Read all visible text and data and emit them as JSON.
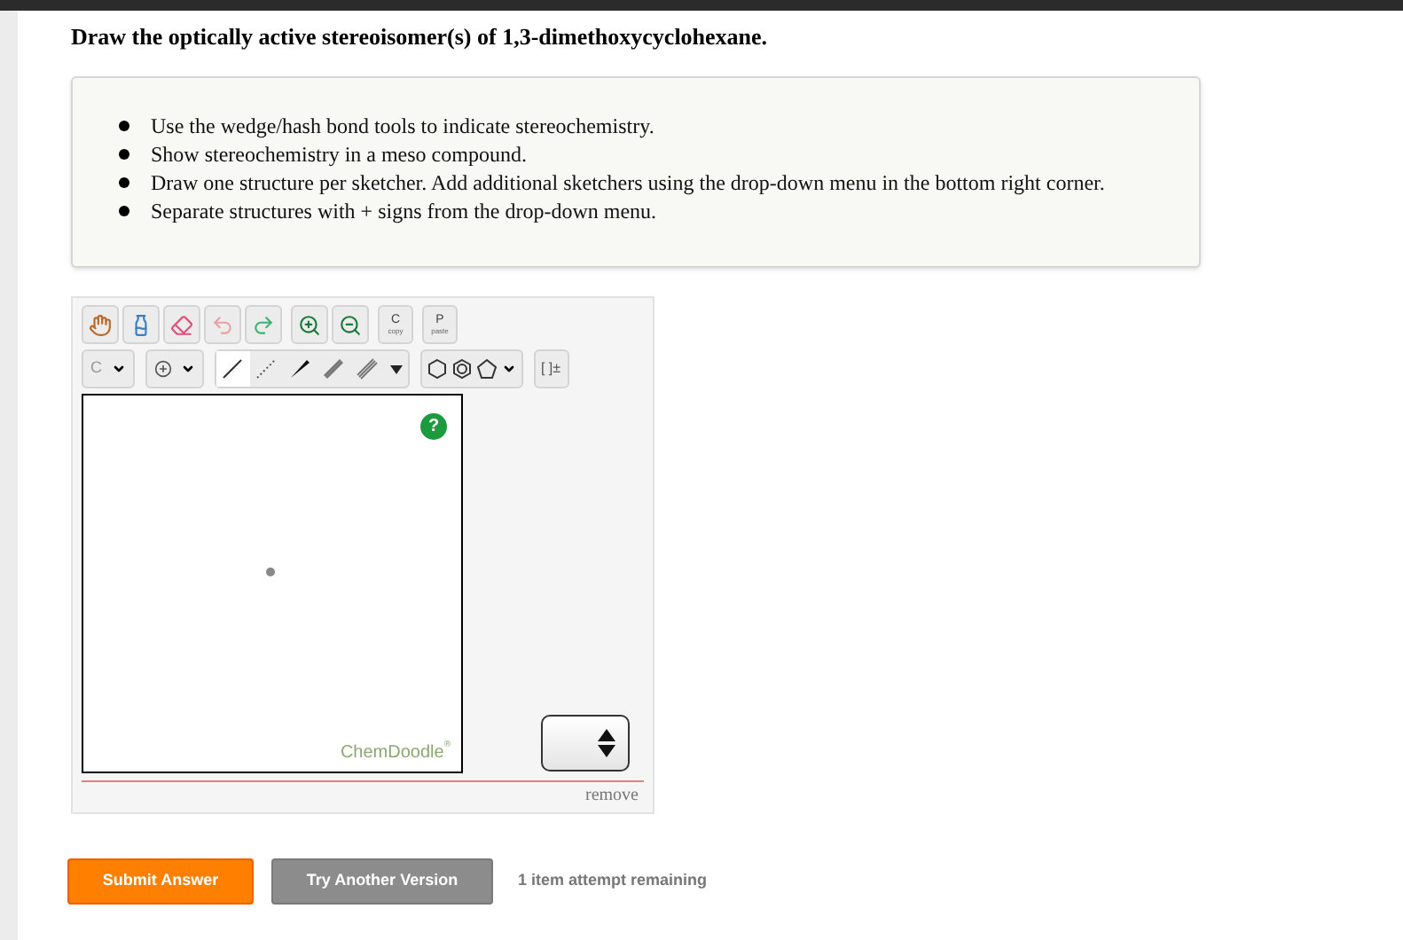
{
  "question": "Draw the optically active stereoisomer(s) of 1,3-dimethoxycyclohexane.",
  "instructions": [
    "Use the wedge/hash bond tools to indicate stereochemistry.",
    "Show stereochemistry in a meso compound.",
    "Draw one structure per sketcher. Add additional sketchers using the drop-down menu in the bottom right corner.",
    "Separate structures with + signs from the drop-down menu."
  ],
  "sketcher": {
    "copy": {
      "letter": "C",
      "label": "copy"
    },
    "paste": {
      "letter": "P",
      "label": "paste"
    },
    "element": "C",
    "bond_tools": [
      {
        "kind": "single",
        "selected": true
      },
      {
        "kind": "hash",
        "selected": false
      },
      {
        "kind": "wedge",
        "selected": false
      },
      {
        "kind": "double",
        "selected": false
      },
      {
        "kind": "triple",
        "selected": false
      }
    ],
    "charge": "[ ]±",
    "help": "?",
    "brand": "ChemDoodle",
    "brand_mark": "®",
    "remove": "remove"
  },
  "buttons": [
    {
      "label": "Submit Answer",
      "kind": "primary"
    },
    {
      "label": "Try Another Version",
      "kind": "secondary"
    }
  ],
  "attempts": "1 item attempt remaining"
}
